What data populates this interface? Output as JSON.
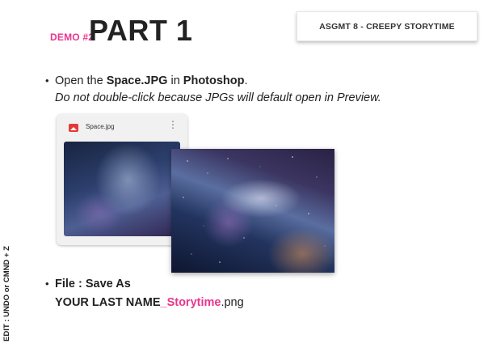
{
  "header": {
    "demo_label": "DEMO #2",
    "title": "PART 1",
    "badge": "ASGMT 8 - CREEPY STORYTIME"
  },
  "bullet1": {
    "dot": "•",
    "open": "Open the ",
    "file": "Space.JPG",
    "in": " in ",
    "app": "Photoshop",
    "period": ".",
    "note": "Do not double-click because JPGs will default open in Preview."
  },
  "finder": {
    "file_name": "Space.jpg",
    "more_icon": "⋮"
  },
  "side_label": "EDIT : UNDO or CMND + Z",
  "bullet2": {
    "dot": "•",
    "line1": "File : Save As",
    "name_prefix": "YOUR LAST NAME",
    "name_highlight": "_Storytime",
    "extension": ".png"
  },
  "colors": {
    "accent_pink": "#e8358f",
    "icon_red": "#e53935"
  },
  "icons": {
    "file": "image-file-icon",
    "more": "more-vertical-icon"
  }
}
